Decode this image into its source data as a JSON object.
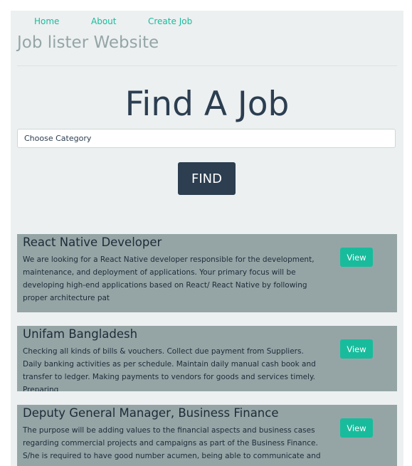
{
  "nav": {
    "items": [
      {
        "label": "Home"
      },
      {
        "label": "About"
      },
      {
        "label": "Create Job"
      }
    ]
  },
  "site_title": "Job lister Website",
  "hero_title": "Find A Job",
  "search": {
    "category_selected": "Choose Category",
    "find_label": "FIND"
  },
  "jobs": [
    {
      "title": "React Native Developer",
      "description": "We are looking for a React Native developer responsible for the development, maintenance, and deployment of applications. Your primary focus will be developing high-end applications based on React/ React Native by following proper architecture pat",
      "view_label": "View"
    },
    {
      "title": "Unifam Bangladesh",
      "description": "Checking all kinds of bills & vouchers. Collect due payment from Suppliers. Daily banking activities as per schedule. Maintain daily manual cash book and transfer to ledger. Making payments to vendors for goods and services timely. Preparing",
      "view_label": "View"
    },
    {
      "title": "Deputy General Manager, Business Finance",
      "description": "The purpose will be adding values to the financial aspects and business cases regarding commercial projects and campaigns as part of the Business Finance. S/he is required to have good number acumen, being able to communicate and",
      "view_label": "View"
    }
  ],
  "colors": {
    "accent": "#18bc9c",
    "primary": "#2c3e50",
    "muted": "#95a5a6",
    "panel": "#ecf0f1"
  }
}
